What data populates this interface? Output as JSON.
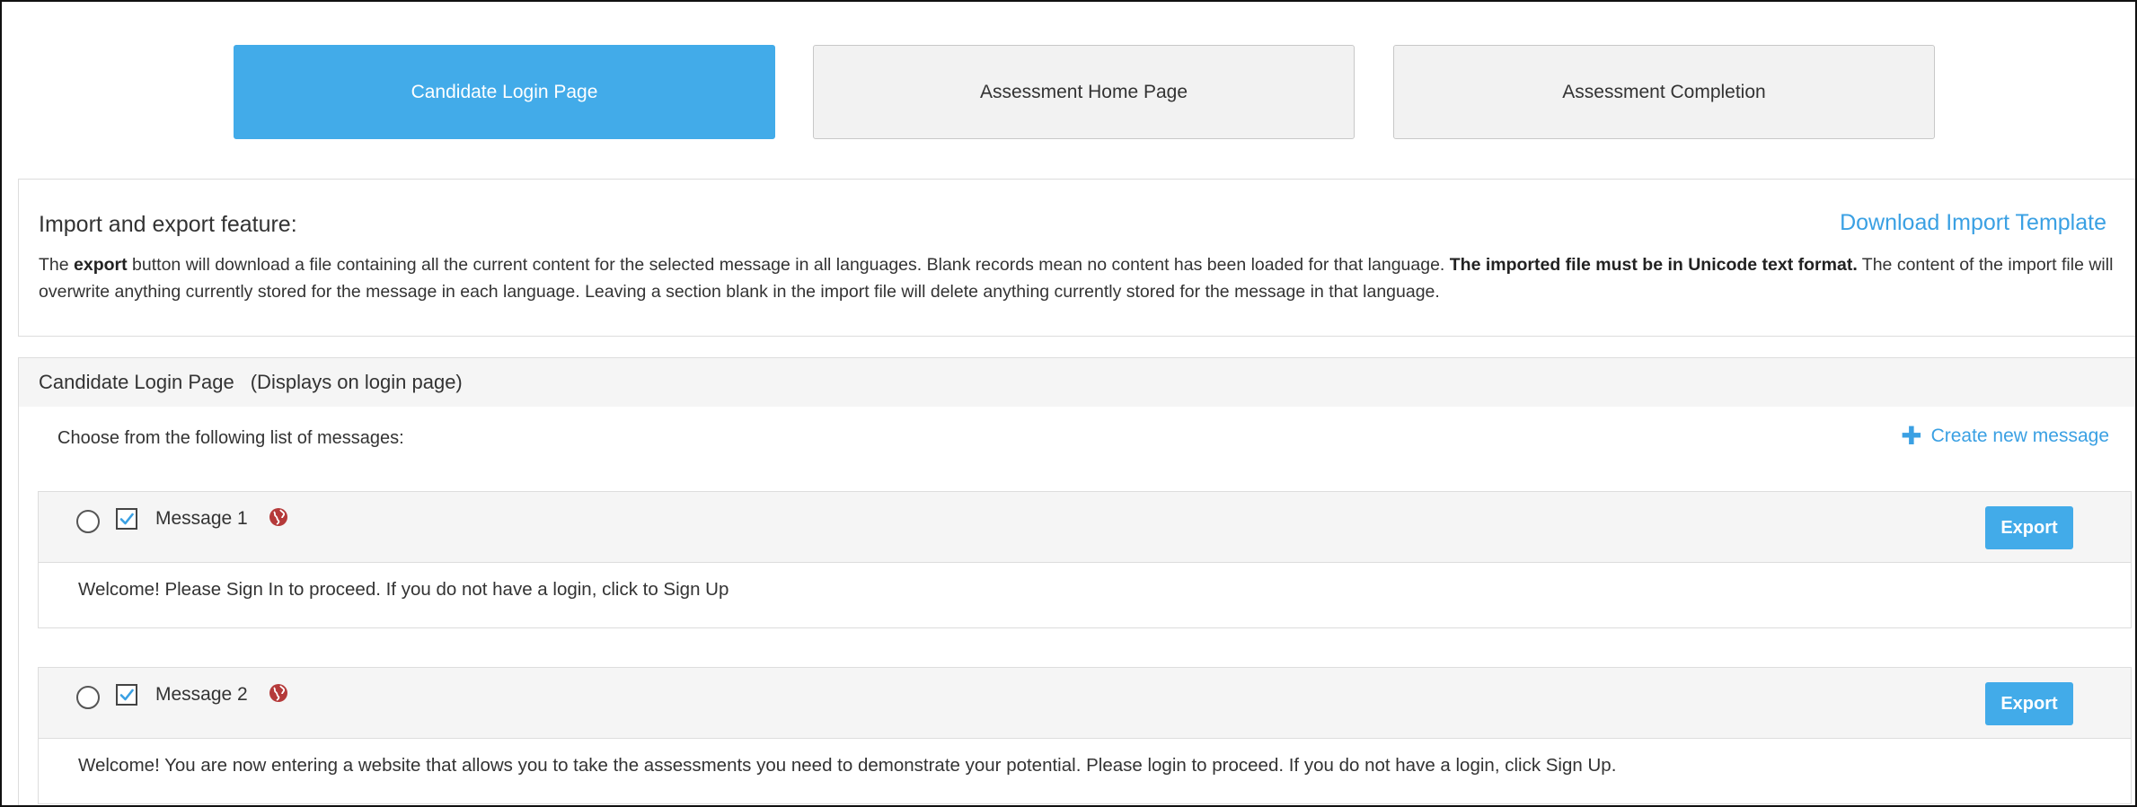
{
  "tabs": [
    {
      "label": "Candidate Login Page",
      "active": true
    },
    {
      "label": "Assessment Home Page",
      "active": false
    },
    {
      "label": "Assessment Completion",
      "active": false
    }
  ],
  "info": {
    "title": "Import and export feature:",
    "download_link": "Download Import Template",
    "text_1": "The ",
    "text_bold_1": "export",
    "text_2": " button will download a file containing all the current content for the selected message in all languages. Blank records mean no content has been loaded for that language. ",
    "text_bold_2": "The imported file must be in Unicode text format.",
    "text_3": " The content of the import file will overwrite anything currently stored for the message in each language. Leaving a section blank in the import file will delete anything currently stored for the message in that language."
  },
  "section": {
    "title": "Candidate Login Page",
    "description": "(Displays on login page)",
    "choose_label": "Choose from the following list of messages:",
    "create_link": "Create new message"
  },
  "messages": [
    {
      "name": "Message 1",
      "checked": true,
      "selected": false,
      "export_label": "Export",
      "content": "Welcome! Please Sign In to proceed. If you do not have a login, click to Sign Up"
    },
    {
      "name": "Message 2",
      "checked": true,
      "selected": false,
      "export_label": "Export",
      "content": "Welcome! You are now entering a website that allows you to take the assessments you need to demonstrate your potential. Please login to proceed. If you do not have a login, click Sign Up."
    }
  ],
  "colors": {
    "accent": "#42abe9",
    "link": "#3aa0e3",
    "globe": "#b53a3a"
  },
  "icons": {
    "plus": "plus-icon",
    "globe": "globe-icon",
    "check": "checkmark-icon"
  }
}
